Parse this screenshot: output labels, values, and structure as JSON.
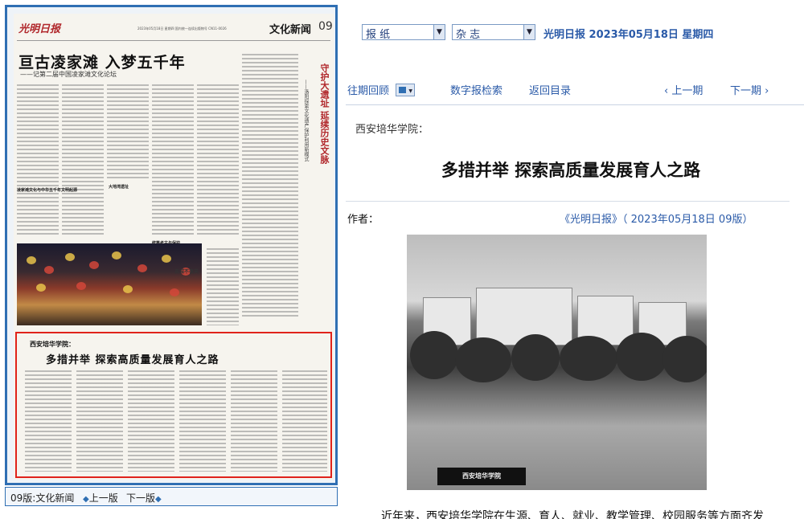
{
  "newspaper": {
    "logo": "光明日报",
    "dateline": "2023年05月18日 星期四 国内统一连续出版物号 CN11-0026",
    "section_name": "文化新闻",
    "page_number": "09",
    "headline": "亘古凌家滩  入梦五千年",
    "subheadline": "——记第二届中国凌家滩文化论坛",
    "right_vertical_title": "守护大遗址 延续历史文脉",
    "right_vertical_sub": "——洛阳探索文化遗产保护利用新模式",
    "photo_caption": "古城不夜天",
    "mini_heads": [
      "凌家滩文化与中华五千年文明起源",
      "大地湾遗址",
      "统筹考古与保护"
    ],
    "highlight_kicker": "西安培华学院：",
    "highlight_title": "多措并举  探索高质量发展育人之路"
  },
  "edition_bar": {
    "edition": "09版:文化新闻",
    "prev": "上一版",
    "next": "下一版"
  },
  "selectors": {
    "paper_select": "报  纸",
    "magazine_select": "杂  志"
  },
  "paper_date": "光明日报  2023年05月18日  星期四",
  "nav": {
    "archive": "往期回顾",
    "digital": "数字报检索",
    "back": "返回目录",
    "prev_page": "上一期",
    "next_page": "下一期"
  },
  "article": {
    "kicker": "西安培华学院：",
    "title": "多措并举  探索高质量发展育人之路",
    "author_label": "作者：",
    "source": "《光明日报》（ 2023年05月18日   09版）",
    "photo_sign": "西安培华学院",
    "lead": "近年来，西安培华学院在生源、育人、就业、教学管理、校园服务等方面齐发"
  }
}
